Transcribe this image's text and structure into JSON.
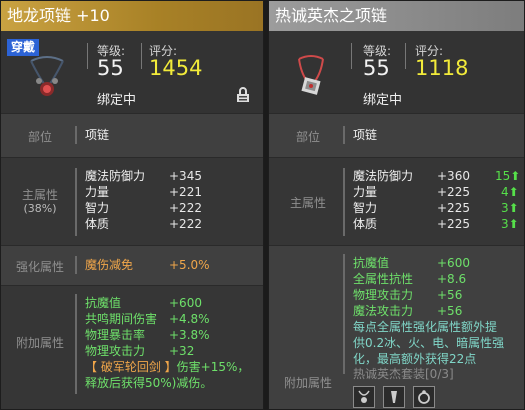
{
  "left": {
    "title": "地龙项链 +10",
    "wear_badge": "穿戴",
    "level_label": "等级:",
    "level": "55",
    "score_label": "评分:",
    "score": "1454",
    "bound": "绑定中",
    "slot_label": "部位",
    "slot_value": "项链",
    "main_label": "主属性",
    "main_pct": "(38%)",
    "main_stats": [
      {
        "name": "魔法防御力",
        "value": "+345"
      },
      {
        "name": "力量",
        "value": "+221"
      },
      {
        "name": "智力",
        "value": "+222"
      },
      {
        "name": "体质",
        "value": "+222"
      }
    ],
    "enh_label": "强化属性",
    "enh_name": "魔伤减免",
    "enh_value": "+5.0%",
    "add_label": "附加属性",
    "add_stats": [
      {
        "name": "抗魔值",
        "value": "+600"
      },
      {
        "name": "共鸣期间伤害",
        "value": "+4.8%"
      },
      {
        "name": "物理暴击率",
        "value": "+3.8%"
      },
      {
        "name": "物理攻击力",
        "value": "+32"
      }
    ],
    "skill_line1_name": "【 破军轮回剑 】",
    "skill_line1_rest": "伤害+15%，",
    "skill_line2": "释放后获得50%)减伤。"
  },
  "right": {
    "title": "热诚英杰之项链",
    "level_label": "等级:",
    "level": "55",
    "score_label": "评分:",
    "score": "1118",
    "bound": "绑定中",
    "slot_label": "部位",
    "slot_value": "项链",
    "main_label": "主属性",
    "main_stats": [
      {
        "name": "魔法防御力",
        "value": "+360",
        "cmp": "15"
      },
      {
        "name": "力量",
        "value": "+225",
        "cmp": "4"
      },
      {
        "name": "智力",
        "value": "+225",
        "cmp": "3"
      },
      {
        "name": "体质",
        "value": "+225",
        "cmp": "3"
      }
    ],
    "add_label": "附加属性",
    "add_stats": [
      {
        "name": "抗魔值",
        "value": "+600"
      },
      {
        "name": "全属性抗性",
        "value": "+8.6"
      },
      {
        "name": "物理攻击力",
        "value": "+56"
      },
      {
        "name": "魔法攻击力",
        "value": "+56"
      }
    ],
    "desc_line1": "每点全属性强化属性额外提",
    "desc_line2": "供0.2冰、火、电、暗属性强",
    "desc_line3": "化，最高额外获得22点",
    "set_label": "热诚英杰套装[0/3]"
  },
  "colors": {
    "gold_title": "#b8912f",
    "score": "#f2eb3a",
    "green": "#6ee06a",
    "orange": "#f0a64a",
    "teal": "#80d6c8",
    "badge": "#2c63d6"
  }
}
